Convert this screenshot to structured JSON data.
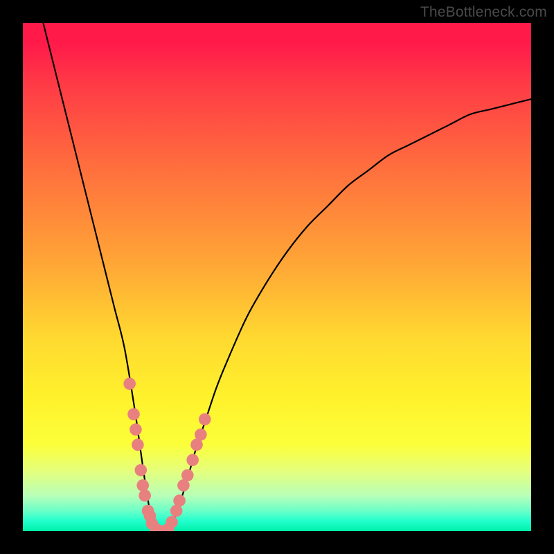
{
  "watermark": "TheBottleneck.com",
  "chart_data": {
    "type": "line",
    "title": "",
    "xlabel": "",
    "ylabel": "",
    "xlim": [
      0,
      100
    ],
    "ylim": [
      0,
      100
    ],
    "series": [
      {
        "name": "bottleneck-curve",
        "x": [
          4,
          6,
          8,
          10,
          12,
          14,
          16,
          18,
          20,
          22,
          23,
          24,
          25,
          26,
          27,
          28,
          29,
          30,
          32,
          34,
          36,
          38,
          40,
          44,
          48,
          52,
          56,
          60,
          64,
          68,
          72,
          76,
          80,
          84,
          88,
          92,
          96,
          100
        ],
        "y": [
          100,
          92,
          84,
          76,
          68,
          60,
          52,
          44,
          36,
          24,
          17,
          10,
          4,
          1,
          0,
          0,
          1,
          3,
          9,
          16,
          22,
          28,
          33,
          42,
          49,
          55,
          60,
          64,
          68,
          71,
          74,
          76,
          78,
          80,
          82,
          83,
          84,
          85
        ]
      }
    ],
    "markers": {
      "name": "highlight-dots",
      "points": [
        {
          "x": 21.0,
          "y": 29
        },
        {
          "x": 21.8,
          "y": 23
        },
        {
          "x": 22.2,
          "y": 20
        },
        {
          "x": 22.6,
          "y": 17
        },
        {
          "x": 23.2,
          "y": 12
        },
        {
          "x": 23.6,
          "y": 9
        },
        {
          "x": 24.0,
          "y": 7
        },
        {
          "x": 24.6,
          "y": 4
        },
        {
          "x": 25.0,
          "y": 3
        },
        {
          "x": 25.4,
          "y": 1.5
        },
        {
          "x": 26.2,
          "y": 0.4
        },
        {
          "x": 27.0,
          "y": 0.0
        },
        {
          "x": 27.8,
          "y": 0.0
        },
        {
          "x": 28.6,
          "y": 0.4
        },
        {
          "x": 29.3,
          "y": 1.8
        },
        {
          "x": 30.2,
          "y": 4
        },
        {
          "x": 30.8,
          "y": 6
        },
        {
          "x": 31.6,
          "y": 9
        },
        {
          "x": 32.4,
          "y": 11
        },
        {
          "x": 33.4,
          "y": 14
        },
        {
          "x": 34.2,
          "y": 17
        },
        {
          "x": 35.0,
          "y": 19
        },
        {
          "x": 35.8,
          "y": 22
        }
      ]
    },
    "gradient_stops": [
      {
        "pos": 0.0,
        "color": "#ff1a4a"
      },
      {
        "pos": 0.27,
        "color": "#ff6a3e"
      },
      {
        "pos": 0.62,
        "color": "#ffd930"
      },
      {
        "pos": 0.83,
        "color": "#fbff3a"
      },
      {
        "pos": 0.96,
        "color": "#6bffc8"
      },
      {
        "pos": 1.0,
        "color": "#00f0a8"
      }
    ]
  }
}
